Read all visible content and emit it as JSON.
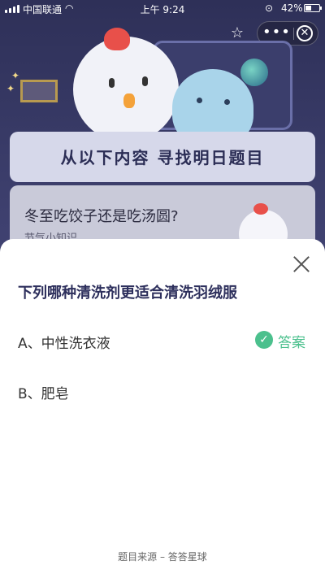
{
  "status_bar": {
    "carrier": "中国联通",
    "time": "上午 9:24",
    "battery": "42%"
  },
  "header": {
    "icons": [
      "star-icon",
      "more-dots-icon",
      "close-circle-icon"
    ],
    "more_glyph": "•••"
  },
  "banner": {
    "title": "从以下内容 寻找明日题目"
  },
  "card": {
    "question": "冬至吃饺子还是吃汤圆?",
    "subtitle": "节气小知识"
  },
  "sheet": {
    "question": "下列哪种清洗剂更适合清洗羽绒服",
    "options": [
      {
        "label": "A、中性洗衣液",
        "is_answer": true
      },
      {
        "label": "B、肥皂",
        "is_answer": false
      }
    ],
    "answer_label": "答案",
    "footer": "题目来源 – 答答星球",
    "colors": {
      "answer": "#4bc08d",
      "question": "#2d2f5c"
    }
  }
}
